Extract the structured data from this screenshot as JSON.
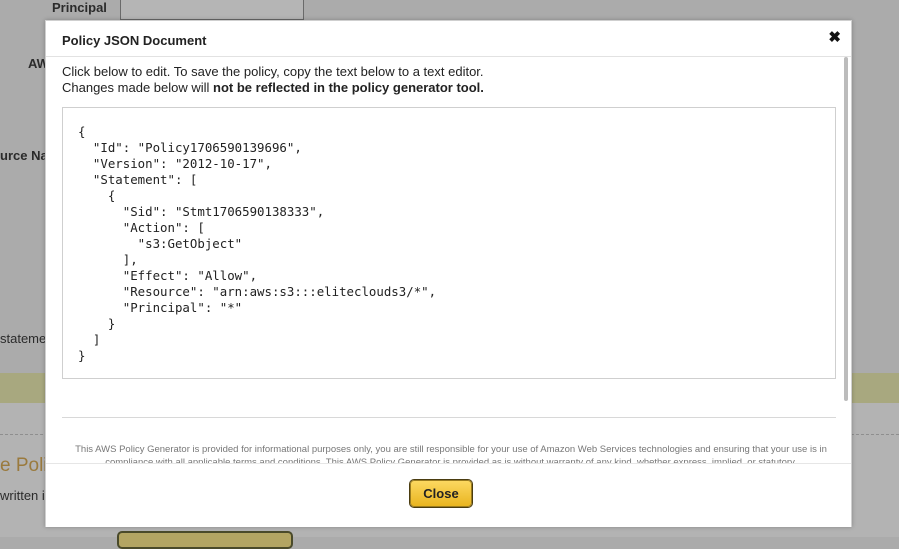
{
  "background": {
    "principal_label": "Principal",
    "aws_label": "AW",
    "resource_label": "urce Na",
    "statement_label": "stateme",
    "policy_heading": "e Polic",
    "written_text": "written in"
  },
  "modal": {
    "title": "Policy JSON Document",
    "close_icon": "✖",
    "intro_line1": "Click below to edit. To save the policy, copy the text below to a text editor.",
    "intro_line2_prefix": "Changes made below will ",
    "intro_line2_bold": "not be reflected in the policy generator tool.",
    "json_document": "{\n  \"Id\": \"Policy1706590139696\",\n  \"Version\": \"2012-10-17\",\n  \"Statement\": [\n    {\n      \"Sid\": \"Stmt1706590138333\",\n      \"Action\": [\n        \"s3:GetObject\"\n      ],\n      \"Effect\": \"Allow\",\n      \"Resource\": \"arn:aws:s3:::eliteclouds3/*\",\n      \"Principal\": \"*\"\n    }\n  ]\n}",
    "disclaimer": "This AWS Policy Generator is provided for informational purposes only, you are still responsible for your use of Amazon Web Services technologies and ensuring that your use is in compliance with all applicable terms and conditions. This AWS Policy Generator is provided as is without warranty of any kind, whether express, implied, or statutory.",
    "close_button_label": "Close"
  }
}
